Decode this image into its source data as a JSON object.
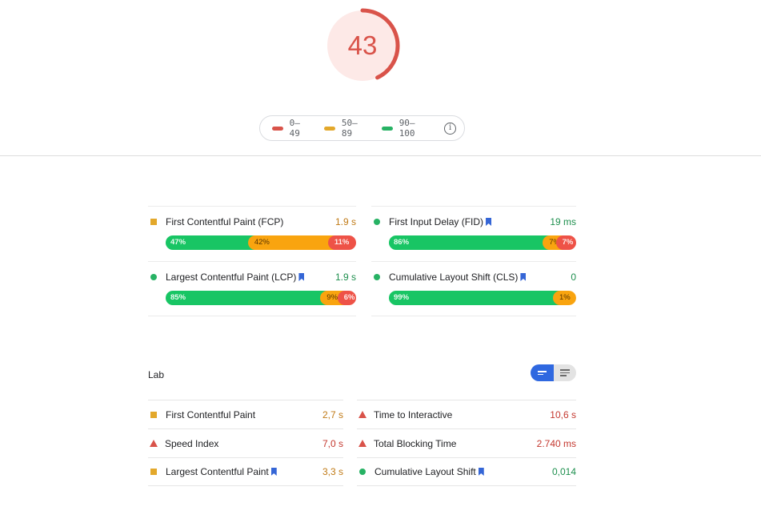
{
  "score": {
    "value": "43",
    "fraction": 0.43,
    "color": "#d9534a",
    "background": "#fde9e7"
  },
  "legend": {
    "items": [
      {
        "label": "0–49",
        "color": "#d9534a"
      },
      {
        "label": "50–89",
        "color": "#e3a82b"
      },
      {
        "label": "90–100",
        "color": "#27b264"
      }
    ],
    "info_icon": "i"
  },
  "field_data": {
    "left": [
      {
        "label": "First Contentful Paint (FCP)",
        "value": "1.9 s",
        "status": "average",
        "icon": "square-icon",
        "bookmark": false,
        "distribution": [
          {
            "label": "47%",
            "percent": 47,
            "kind": "fast"
          },
          {
            "label": "42%",
            "percent": 42,
            "kind": "average"
          },
          {
            "label": "11%",
            "percent": 11,
            "kind": "slow"
          }
        ]
      },
      {
        "label": "Largest Contentful Paint (LCP)",
        "value": "1.9 s",
        "status": "good",
        "icon": "circle-icon",
        "bookmark": true,
        "distribution": [
          {
            "label": "85%",
            "percent": 85,
            "kind": "fast"
          },
          {
            "label": "9%",
            "percent": 9,
            "kind": "average"
          },
          {
            "label": "6%",
            "percent": 6,
            "kind": "slow"
          }
        ]
      }
    ],
    "right": [
      {
        "label": "First Input Delay (FID)",
        "value": "19 ms",
        "status": "good",
        "icon": "circle-icon",
        "bookmark": true,
        "distribution": [
          {
            "label": "86%",
            "percent": 86,
            "kind": "fast"
          },
          {
            "label": "7%",
            "percent": 7,
            "kind": "average"
          },
          {
            "label": "7%",
            "percent": 7,
            "kind": "slow"
          }
        ]
      },
      {
        "label": "Cumulative Layout Shift (CLS)",
        "value": "0",
        "status": "good",
        "icon": "circle-icon",
        "bookmark": true,
        "distribution": [
          {
            "label": "99%",
            "percent": 99,
            "kind": "fast"
          },
          {
            "label": "1%",
            "percent": 1,
            "kind": "average"
          }
        ]
      }
    ]
  },
  "lab": {
    "title": "Lab",
    "left": [
      {
        "label": "First Contentful Paint",
        "value": "2,7 s",
        "status": "avg",
        "icon": "square",
        "bookmark": false
      },
      {
        "label": "Speed Index",
        "value": "7,0 s",
        "status": "bad",
        "icon": "triangle",
        "bookmark": false
      },
      {
        "label": "Largest Contentful Paint",
        "value": "3,3 s",
        "status": "avg",
        "icon": "square",
        "bookmark": true
      }
    ],
    "right": [
      {
        "label": "Time to Interactive",
        "value": "10,6 s",
        "status": "bad",
        "icon": "triangle",
        "bookmark": false
      },
      {
        "label": "Total Blocking Time",
        "value": "2.740 ms",
        "status": "bad",
        "icon": "triangle",
        "bookmark": false
      },
      {
        "label": "Cumulative Layout Shift",
        "value": "0,014",
        "status": "good",
        "icon": "circle",
        "bookmark": true
      }
    ],
    "view_toggle": {
      "options": [
        "compact-view",
        "expanded-view"
      ],
      "active": "compact-view"
    }
  }
}
